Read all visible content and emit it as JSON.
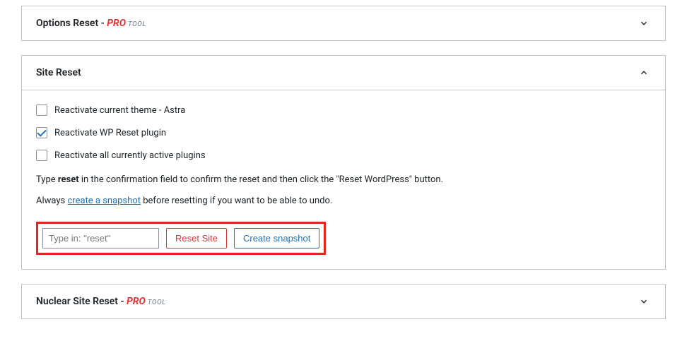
{
  "panels": {
    "options_reset": {
      "title_prefix": "Options Reset - ",
      "pro": "PRO",
      "tool": " TOOL"
    },
    "site_reset": {
      "title": "Site Reset",
      "checkboxes": [
        {
          "label": "Reactivate current theme - Astra",
          "checked": false
        },
        {
          "label": "Reactivate WP Reset plugin",
          "checked": true
        },
        {
          "label": "Reactivate all currently active plugins",
          "checked": false
        }
      ],
      "desc1_a": "Type ",
      "desc1_b": "reset",
      "desc1_c": " in the confirmation field to confirm the reset and then click the \"Reset WordPress\" button.",
      "desc2_a": "Always ",
      "desc2_link": "create a snapshot",
      "desc2_b": " before resetting if you want to be able to undo.",
      "input_placeholder": "Type in: \"reset\"",
      "reset_btn": "Reset Site",
      "snapshot_btn": "Create snapshot"
    },
    "nuclear_reset": {
      "title_prefix": "Nuclear Site Reset - ",
      "pro": "PRO",
      "tool": " TOOL"
    }
  }
}
